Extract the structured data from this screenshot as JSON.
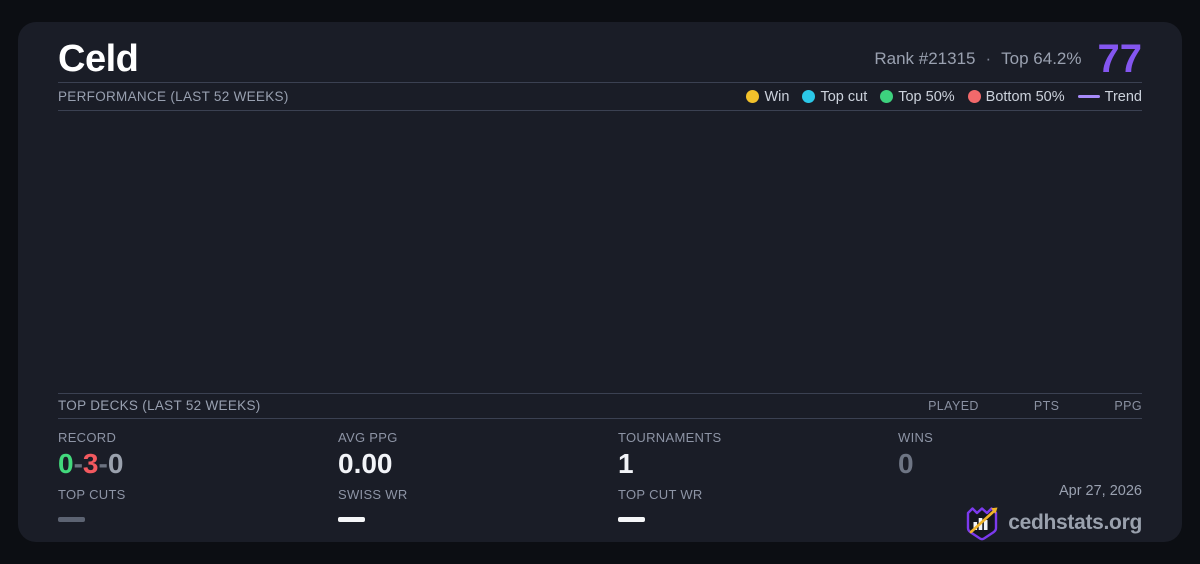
{
  "header": {
    "title": "Celd",
    "rank_text": "Rank #21315",
    "separator": "·",
    "top_percent": "Top 64.2%",
    "score": "77",
    "score_color": "#8456f0"
  },
  "performance": {
    "section_title": "PERFORMANCE (LAST 52 WEEKS)",
    "legend": [
      {
        "label": "Win",
        "color": "#f2c12b",
        "marker": "dot"
      },
      {
        "label": "Top cut",
        "color": "#2bc8e8",
        "marker": "dot"
      },
      {
        "label": "Top 50%",
        "color": "#3dd27e",
        "marker": "dot"
      },
      {
        "label": "Bottom 50%",
        "color": "#f2696b",
        "marker": "dot"
      },
      {
        "label": "Trend",
        "color": "#a78bfa",
        "marker": "line"
      }
    ]
  },
  "chart_data": {
    "type": "scatter",
    "title": "PERFORMANCE (LAST 52 WEEKS)",
    "series": [],
    "x": [],
    "legend_position": "top-right",
    "grid": false
  },
  "top_decks": {
    "section_title": "TOP DECKS (LAST 52 WEEKS)",
    "columns": [
      "PLAYED",
      "PTS",
      "PPG"
    ]
  },
  "stats": {
    "record": {
      "label": "RECORD",
      "wins": "0",
      "losses": "3",
      "draws": "0",
      "sep": "-"
    },
    "avg_ppg": {
      "label": "AVG PPG",
      "value": "0.00"
    },
    "tournaments": {
      "label": "TOURNAMENTS",
      "value": "1"
    },
    "wins": {
      "label": "WINS",
      "value": "0"
    },
    "top_cuts": {
      "label": "TOP CUTS",
      "value": "—"
    },
    "swiss_wr": {
      "label": "SWISS WR",
      "value": "—"
    },
    "top_cut_wr": {
      "label": "TOP CUT WR",
      "value": "—"
    }
  },
  "footer": {
    "date": "Apr 27, 2026",
    "brand": "cedhstats.org"
  },
  "colors": {
    "card_bg": "#1a1d27",
    "page_bg": "#0c0e13",
    "accent_purple": "#8456f0",
    "record_win": "#42d97c",
    "record_loss": "#f2595f",
    "record_draw": "#9aa1ad"
  }
}
